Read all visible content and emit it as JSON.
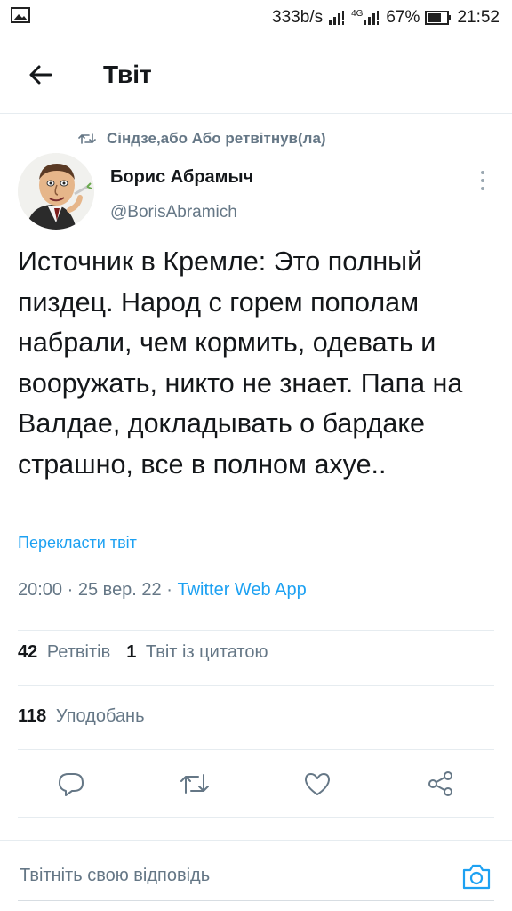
{
  "status_bar": {
    "network_speed": "333b/s",
    "network_type": "4G",
    "battery": "67%",
    "time": "21:52",
    "icons": [
      "image-notification-icon",
      "signal-icon",
      "4g-signal-icon",
      "battery-icon"
    ]
  },
  "header": {
    "title": "Твіт",
    "back_icon": "arrow-left-icon"
  },
  "retweet_context": {
    "icon": "retweet-icon",
    "text": "Сіндзе,або Або ретвітнув(ла)"
  },
  "tweet": {
    "author_name": "Борис Абрамыч",
    "author_handle": "@BorisAbramich",
    "text": "Источник в Кремле: Это полный пиздец. Народ с горем пополам набрали, чем кормить, одевать и вооружать, никто не знает. Папа на Валдае, докладывать о бардаке страшно, все в полном ахуе..",
    "translate_label": "Перекласти твіт",
    "time": "20:00",
    "date": "25 вер. 22",
    "separator": "·",
    "source": "Twitter Web App",
    "retweets_count": "42",
    "retweets_label": "Ретвітів",
    "quotes_count": "1",
    "quotes_label": "Твіт із цитатою",
    "likes_count": "118",
    "likes_label": "Уподобань"
  },
  "actions": [
    {
      "name": "reply",
      "icon": "reply-icon"
    },
    {
      "name": "retweet",
      "icon": "retweet-icon"
    },
    {
      "name": "like",
      "icon": "heart-icon"
    },
    {
      "name": "share",
      "icon": "share-icon"
    }
  ],
  "reply_bar": {
    "placeholder": "Твітніть свою відповідь",
    "camera_icon": "camera-icon"
  },
  "colors": {
    "accent": "#1da1f2",
    "secondary_text": "#657786",
    "primary_text": "#14171a",
    "divider": "#e6ecf0"
  }
}
